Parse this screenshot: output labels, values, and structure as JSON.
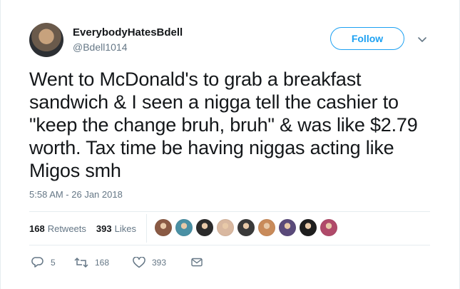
{
  "user": {
    "display_name": "EverybodyHatesBdell",
    "handle": "@Bdell1014"
  },
  "follow_button": {
    "label": "Follow"
  },
  "tweet": {
    "text": "Went to McDonald's to grab a breakfast sandwich & I seen a nigga tell the cashier to \"keep the change bruh, bruh\" & was like $2.79 worth. Tax time be having niggas acting like Migos smh",
    "timestamp": "5:58 AM - 26 Jan 2018"
  },
  "stats": {
    "retweets_count": "168",
    "retweets_label": "Retweets",
    "likes_count": "393",
    "likes_label": "Likes"
  },
  "liker_avatars": [
    {
      "color": "#8a5a44"
    },
    {
      "color": "#4a90a4"
    },
    {
      "color": "#2b2b2b"
    },
    {
      "color": "#d9b8a0"
    },
    {
      "color": "#3a3a3a"
    },
    {
      "color": "#c98b5a"
    },
    {
      "color": "#5a4a7a"
    },
    {
      "color": "#1e1e1e"
    },
    {
      "color": "#b04a6a"
    }
  ],
  "actions": {
    "reply_count": "5",
    "retweet_count": "168",
    "like_count": "393"
  },
  "icons": {
    "caret": "chevron-down-icon",
    "reply": "reply-icon",
    "retweet": "retweet-icon",
    "like": "heart-icon",
    "dm": "envelope-icon"
  },
  "colors": {
    "accent": "#1da1f2",
    "muted": "#657786",
    "text": "#14171a",
    "divider": "#e6ecf0"
  }
}
